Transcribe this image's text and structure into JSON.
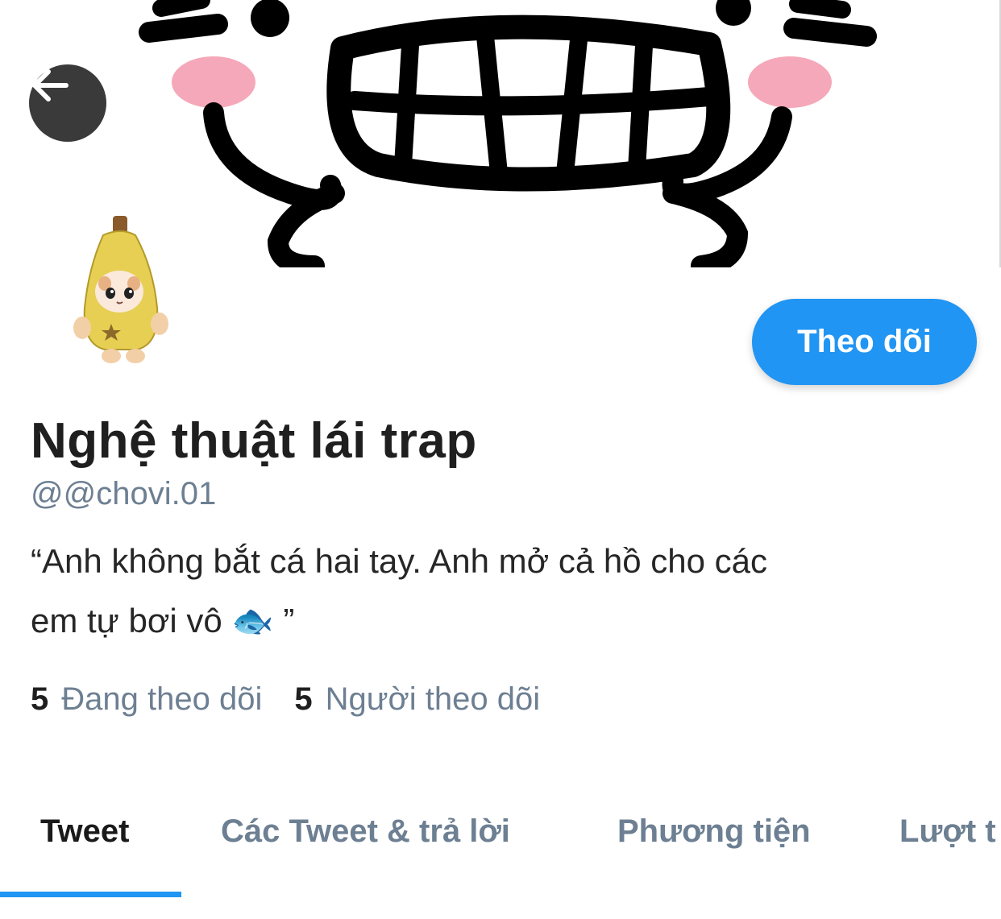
{
  "header": {
    "back_button_icon": "arrow-left-icon",
    "banner_icon": "smiling-face-drawing"
  },
  "profile": {
    "avatar_icon": "banana-cat-sticker",
    "follow_label": "Theo dõi",
    "display_name": "Nghệ thuật lái trap",
    "handle": "@@chovi.01",
    "bio_line1": "“Anh không bắt cá hai tay. Anh mở cả hồ cho các",
    "bio_line2": "em tự bơi vô",
    "bio_emoji": "🐟",
    "bio_end": "”"
  },
  "stats": {
    "following_count": "5",
    "following_label": "Đang theo dõi",
    "followers_count": "5",
    "followers_label": "Người theo dõi"
  },
  "tabs": [
    {
      "label": "Tweet",
      "active": true
    },
    {
      "label": "Các Tweet & trả lời",
      "active": false
    },
    {
      "label": "Phương tiện",
      "active": false
    },
    {
      "label": "Lượt t",
      "active": false
    }
  ],
  "colors": {
    "accent": "#2195f3",
    "secondary_text": "#6d7f92",
    "primary_text": "#1f1f1f"
  }
}
